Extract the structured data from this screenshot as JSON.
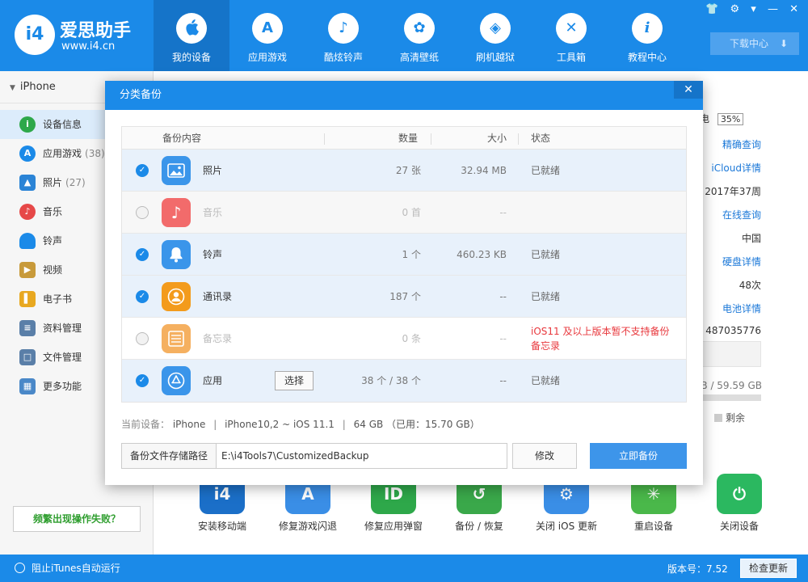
{
  "app": {
    "logo_mark": "i4",
    "name": "爱思助手",
    "url": "www.i4.cn"
  },
  "nav": [
    {
      "label": "我的设备",
      "icon": "apple-icon",
      "glyph": ""
    },
    {
      "label": "应用游戏",
      "icon": "app-store-icon",
      "glyph": "A"
    },
    {
      "label": "酷炫铃声",
      "icon": "bell-icon",
      "glyph": "♪"
    },
    {
      "label": "高清壁纸",
      "icon": "flower-icon",
      "glyph": "✿"
    },
    {
      "label": "刷机越狱",
      "icon": "box-icon",
      "glyph": "◈"
    },
    {
      "label": "工具箱",
      "icon": "tools-icon",
      "glyph": "✕"
    },
    {
      "label": "教程中心",
      "icon": "info-icon",
      "glyph": "i"
    }
  ],
  "window_controls": {
    "shirt": "👕",
    "gear": "⚙",
    "menu": "▾",
    "minimize": "—",
    "close": "✕"
  },
  "download_center": "下载中心",
  "download_arrow": "⬇",
  "sidebar": {
    "device": "iPhone",
    "items": [
      {
        "label": "设备信息",
        "count": "",
        "glyph": "i",
        "color": "#2ea84a"
      },
      {
        "label": "应用游戏",
        "count": "(38)",
        "glyph": "A",
        "color": "#1b8ae8"
      },
      {
        "label": "照片",
        "count": "(27)",
        "glyph": "▲",
        "color": "#2b84d6"
      },
      {
        "label": "音乐",
        "count": "",
        "glyph": "♪",
        "color": "#e64848"
      },
      {
        "label": "铃声",
        "count": "",
        "glyph": "🔔",
        "color": "#1b8ae8"
      },
      {
        "label": "视频",
        "count": "",
        "glyph": "▶",
        "color": "#c89a3a"
      },
      {
        "label": "电子书",
        "count": "",
        "glyph": "▌",
        "color": "#e8a820"
      },
      {
        "label": "资料管理",
        "count": "",
        "glyph": "≡",
        "color": "#5a7fa8"
      },
      {
        "label": "文件管理",
        "count": "",
        "glyph": "□",
        "color": "#5a7fa8"
      },
      {
        "label": "更多功能",
        "count": "",
        "glyph": "▦",
        "color": "#4a88c8"
      }
    ],
    "fail_prompt": "频繁出现操作失败？"
  },
  "background_info": {
    "charging_partial": "电",
    "battery": "35%",
    "precise_query": "精确查询",
    "icloud": "iCloud详情",
    "production_date": "2017年37周",
    "online_query": "在线查询",
    "region": "中国",
    "disk_detail": "硬盘详情",
    "charge_count": "48次",
    "battery_detail": "电池详情",
    "serial_partial": "487035776",
    "storage_partial": "B / 59.59 GB",
    "remaining": "剩余"
  },
  "tools": [
    {
      "label": "安装移动端",
      "glyph": "i4",
      "color": "#1b6fc8"
    },
    {
      "label": "修复游戏闪退",
      "glyph": "A",
      "color": "#3a8ee6"
    },
    {
      "label": "修复应用弹窗",
      "glyph": "ID",
      "color": "#2ea84a"
    },
    {
      "label": "备份 / 恢复",
      "glyph": "↺",
      "color": "#3aa84a"
    },
    {
      "label": "关闭 iOS 更新",
      "glyph": "⚙",
      "color": "#3a8ee6"
    },
    {
      "label": "重启设备",
      "glyph": "✳",
      "color": "#4ab84a"
    },
    {
      "label": "关闭设备",
      "glyph": "⏻",
      "color": "#2bb860"
    }
  ],
  "footer": {
    "itunes_block": "阻止iTunes自动运行",
    "version": "版本号：7.52",
    "check_update": "检查更新"
  },
  "modal": {
    "title": "分类备份",
    "close_glyph": "✕",
    "columns": {
      "content": "备份内容",
      "quantity": "数量",
      "size": "大小",
      "status": "状态"
    },
    "rows": [
      {
        "name": "照片",
        "quantity": "27 张",
        "size": "32.94 MB",
        "status": "已就绪",
        "checked": true,
        "icon_glyph": "▲",
        "icon_color": "#3a95ea"
      },
      {
        "name": "音乐",
        "quantity": "0 首",
        "size": "--",
        "status": "",
        "checked": false,
        "icon_glyph": "♪",
        "icon_color": "#f26b6b"
      },
      {
        "name": "铃声",
        "quantity": "1 个",
        "size": "460.23 KB",
        "status": "已就绪",
        "checked": true,
        "icon_glyph": "◆",
        "icon_color": "#3a95ea"
      },
      {
        "name": "通讯录",
        "quantity": "187 个",
        "size": "--",
        "status": "已就绪",
        "checked": true,
        "icon_glyph": "☺",
        "icon_color": "#f39b1c"
      },
      {
        "name": "备忘录",
        "quantity": "0 条",
        "size": "--",
        "status": "iOS11 及以上版本暂不支持备份备忘录",
        "checked": false,
        "icon_glyph": "≡",
        "icon_color": "#f5b060"
      },
      {
        "name": "应用",
        "quantity": "38 个 / 38 个",
        "size": "--",
        "status": "已就绪",
        "checked": true,
        "icon_glyph": "A",
        "icon_color": "#3a95ea"
      }
    ],
    "select_button": "选择",
    "current_device_label": "当前设备：",
    "current_device": "iPhone",
    "model": "iPhone10,2 ~ iOS 11.1",
    "capacity": "64 GB （已用：15.70 GB）",
    "path_label": "备份文件存储路径",
    "path_value": "E:\\i4Tools7\\CustomizedBackup",
    "modify": "修改",
    "backup_now": "立即备份",
    "check_glyph": "✓"
  }
}
